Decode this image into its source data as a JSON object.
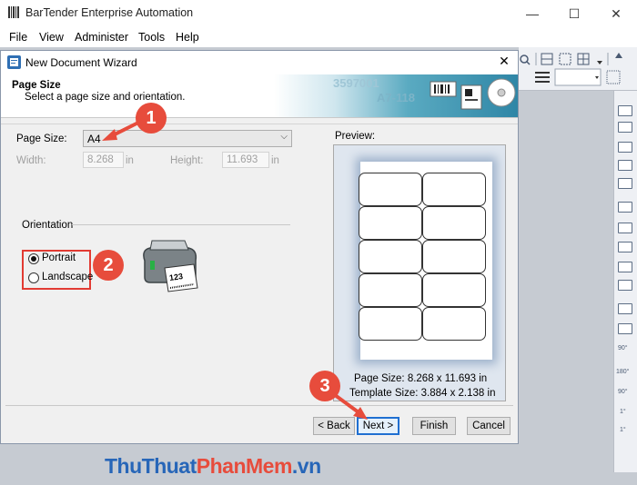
{
  "app": {
    "title": "BarTender Enterprise Automation",
    "minimize": "—",
    "maximize": "☐",
    "close": "✕"
  },
  "menu": [
    "File",
    "View",
    "Administer",
    "Tools",
    "Help"
  ],
  "dialog": {
    "title": "New Document Wizard",
    "close": "✕",
    "header_title": "Page Size",
    "header_subtitle": "Select a page size and orientation.",
    "banner_text": [
      "3597001",
      "A7-118"
    ],
    "page_size_label": "Page Size:",
    "page_size_value": "A4",
    "width_label": "Width:",
    "width_value": "8.268",
    "width_unit": "in",
    "height_label": "Height:",
    "height_value": "11.693",
    "height_unit": "in",
    "orientation_label": "Orientation",
    "portrait_label": "Portrait",
    "landscape_label": "Landscape",
    "portrait_selected": true,
    "printer_label_text": "123",
    "preview_label": "Preview:",
    "preview_page_size": "Page Size:  8.268 x 11.693 in",
    "preview_template_size": "Template Size:  3.884 x 2.138 in",
    "buttons": {
      "back": "< Back",
      "next": "Next >",
      "finish": "Finish",
      "cancel": "Cancel"
    }
  },
  "callouts": [
    "1",
    "2",
    "3"
  ],
  "watermark": {
    "part1": "Thu",
    "part2": "Thuat",
    "part3": "Phan",
    "part4": "Mem",
    "part5": ".vn"
  },
  "vertical_toolbar_labels": [
    "90°",
    "180°",
    "90°",
    "1°",
    "1°"
  ],
  "colors": {
    "accent_red": "#e74c3c",
    "focus_blue": "#1f6fd1",
    "banner_blue": "#2f86a6"
  }
}
